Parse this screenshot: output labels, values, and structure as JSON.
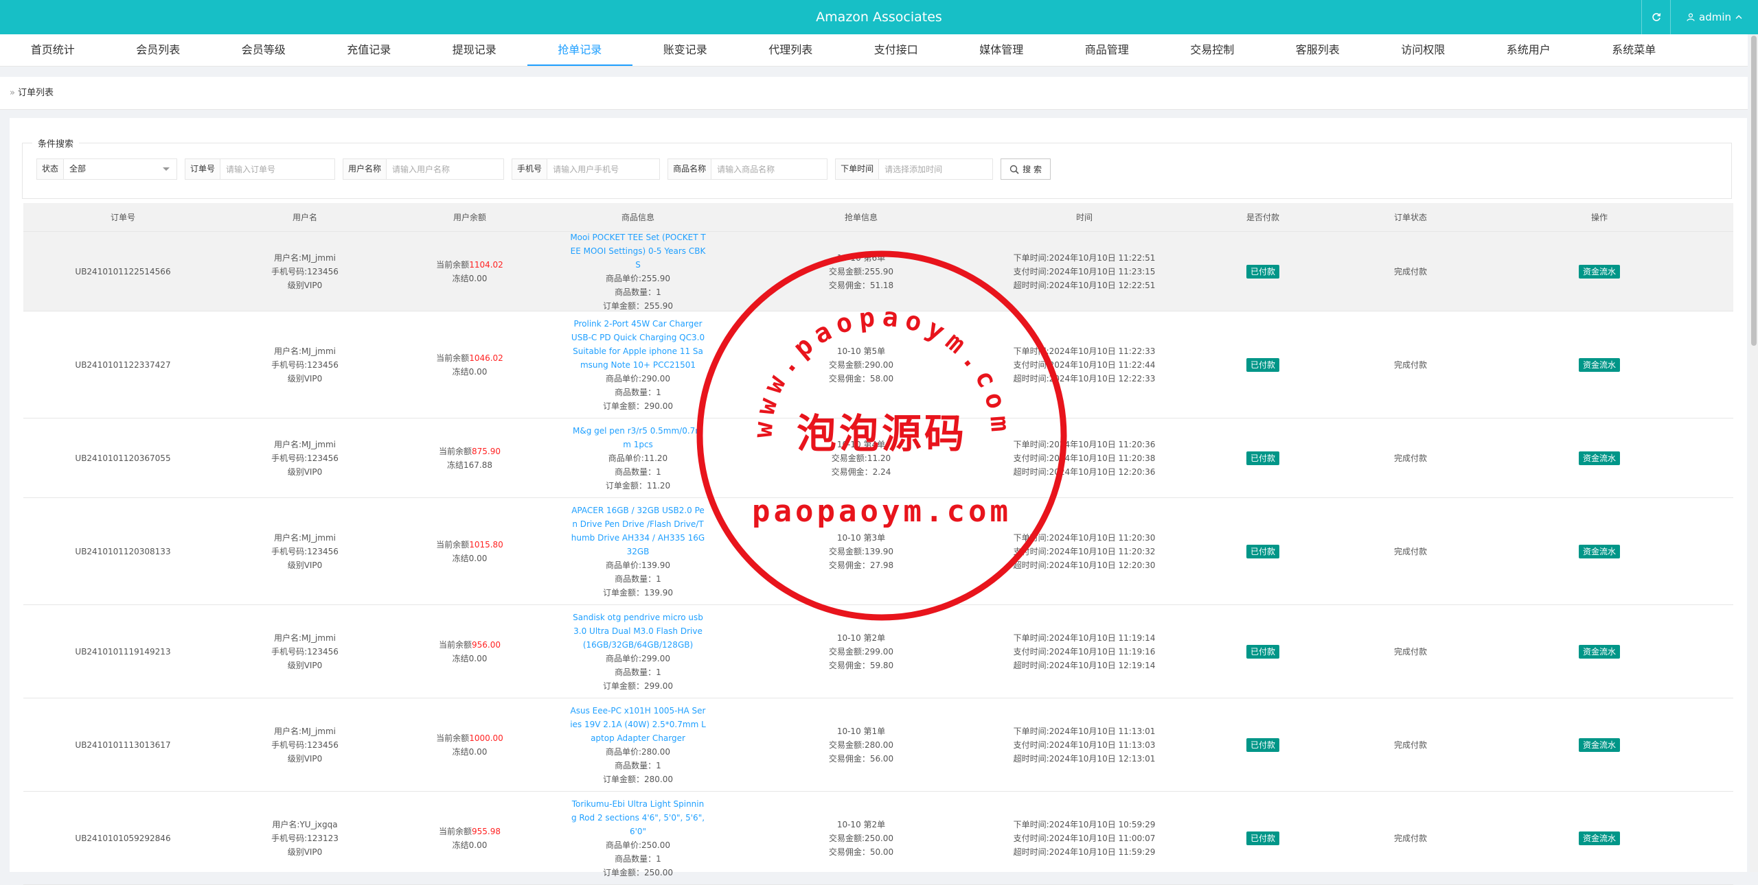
{
  "header": {
    "title": "Amazon Associates",
    "user": "admin",
    "accent": "#17bfc6"
  },
  "nav": [
    "首页统计",
    "会员列表",
    "会员等级",
    "充值记录",
    "提现记录",
    "抢单记录",
    "账变记录",
    "代理列表",
    "支付接口",
    "媒体管理",
    "商品管理",
    "交易控制",
    "客服列表",
    "访问权限",
    "系统用户",
    "系统菜单"
  ],
  "breadcrumb": "订单列表",
  "search": {
    "legend": "条件搜索",
    "status_label": "状态",
    "status_value": "全部",
    "order_label": "订单号",
    "order_placeholder": "请输入订单号",
    "user_label": "用户名称",
    "user_placeholder": "请输入用户名称",
    "phone_label": "手机号",
    "phone_placeholder": "请输入用户手机号",
    "product_label": "商品名称",
    "product_placeholder": "请输入商品名称",
    "time_label": "下单时间",
    "time_placeholder": "请选择添加时间",
    "button": "搜 索"
  },
  "columns": [
    "订单号",
    "用户名",
    "用户余额",
    "商品信息",
    "抢单信息",
    "时间",
    "是否付款",
    "订单状态",
    "操作"
  ],
  "rows": [
    {
      "id": "UB2410101122514566",
      "user": "用户名:MJ_jmmi",
      "phone": "手机号码:123456",
      "level": "级别VIP0",
      "balance_prefix": "当前余额",
      "balance": "1104.02",
      "frozen": "冻结0.00",
      "product": "Mooi POCKET TEE Set (POCKET TEE MOOI Settings) 0-5 Years CBKS",
      "price": "商品单价:255.90",
      "qty": "商品数量：1",
      "amount": "订单金额：255.90",
      "grab1": "10-10 第6单",
      "grab2": "交易金额:255.90",
      "grab3": "交易佣金：51.18",
      "t1": "下单时间:2024年10月10日 11:22:51",
      "t2": "支付时间:2024年10月10日 11:23:15",
      "t3": "超时时间:2024年10月10日 12:22:51",
      "paid": "已付款",
      "state": "完成付款",
      "op": "资金流水"
    },
    {
      "id": "UB2410101122337427",
      "user": "用户名:MJ_jmmi",
      "phone": "手机号码:123456",
      "level": "级别VIP0",
      "balance_prefix": "当前余额",
      "balance": "1046.02",
      "frozen": "冻结0.00",
      "product": "Prolink 2-Port 45W Car Charger USB-C PD Quick Charging QC3.0 Suitable for Apple iphone 11 Samsung Note 10+ PCC21501",
      "price": "商品单价:290.00",
      "qty": "商品数量：1",
      "amount": "订单金额：290.00",
      "grab1": "10-10 第5单",
      "grab2": "交易金额:290.00",
      "grab3": "交易佣金：58.00",
      "t1": "下单时间:2024年10月10日 11:22:33",
      "t2": "支付时间:2024年10月10日 11:22:44",
      "t3": "超时时间:2024年10月10日 12:22:33",
      "paid": "已付款",
      "state": "完成付款",
      "op": "资金流水"
    },
    {
      "id": "UB2410101120367055",
      "user": "用户名:MJ_jmmi",
      "phone": "手机号码:123456",
      "level": "级别VIP0",
      "balance_prefix": "当前余额",
      "balance": "875.90",
      "frozen": "冻结167.88",
      "product": "M&g gel pen r3/r5 0.5mm/0.7mm 1pcs",
      "price": "商品单价:11.20",
      "qty": "商品数量：1",
      "amount": "订单金额：11.20",
      "grab1": "10-10 第4单",
      "grab2": "交易金额:11.20",
      "grab3": "交易佣金：2.24",
      "t1": "下单时间:2024年10月10日 11:20:36",
      "t2": "支付时间:2024年10月10日 11:20:38",
      "t3": "超时时间:2024年10月10日 12:20:36",
      "paid": "已付款",
      "state": "完成付款",
      "op": "资金流水"
    },
    {
      "id": "UB2410101120308133",
      "user": "用户名:MJ_jmmi",
      "phone": "手机号码:123456",
      "level": "级别VIP0",
      "balance_prefix": "当前余额",
      "balance": "1015.80",
      "frozen": "冻结0.00",
      "product": "APACER 16GB / 32GB USB2.0 Pen Drive Pen Drive /Flash Drive/Thumb Drive AH334 / AH335 16G 32GB",
      "price": "商品单价:139.90",
      "qty": "商品数量：1",
      "amount": "订单金额：139.90",
      "grab1": "10-10 第3单",
      "grab2": "交易金额:139.90",
      "grab3": "交易佣金：27.98",
      "t1": "下单时间:2024年10月10日 11:20:30",
      "t2": "支付时间:2024年10月10日 11:20:32",
      "t3": "超时时间:2024年10月10日 12:20:30",
      "paid": "已付款",
      "state": "完成付款",
      "op": "资金流水"
    },
    {
      "id": "UB2410101119149213",
      "user": "用户名:MJ_jmmi",
      "phone": "手机号码:123456",
      "level": "级别VIP0",
      "balance_prefix": "当前余额",
      "balance": "956.00",
      "frozen": "冻结0.00",
      "product": "Sandisk otg pendrive micro usb 3.0 Ultra Dual M3.0 Flash Drive (16GB/32GB/64GB/128GB)",
      "price": "商品单价:299.00",
      "qty": "商品数量：1",
      "amount": "订单金额：299.00",
      "grab1": "10-10 第2单",
      "grab2": "交易金额:299.00",
      "grab3": "交易佣金：59.80",
      "t1": "下单时间:2024年10月10日 11:19:14",
      "t2": "支付时间:2024年10月10日 11:19:16",
      "t3": "超时时间:2024年10月10日 12:19:14",
      "paid": "已付款",
      "state": "完成付款",
      "op": "资金流水"
    },
    {
      "id": "UB2410101113013617",
      "user": "用户名:MJ_jmmi",
      "phone": "手机号码:123456",
      "level": "级别VIP0",
      "balance_prefix": "当前余额",
      "balance": "1000.00",
      "frozen": "冻结0.00",
      "product": "Asus Eee-PC x101H 1005-HA Series 19V 2.1A (40W) 2.5*0.7mm Laptop Adapter Charger",
      "price": "商品单价:280.00",
      "qty": "商品数量：1",
      "amount": "订单金额：280.00",
      "grab1": "10-10 第1单",
      "grab2": "交易金额:280.00",
      "grab3": "交易佣金：56.00",
      "t1": "下单时间:2024年10月10日 11:13:01",
      "t2": "支付时间:2024年10月10日 11:13:03",
      "t3": "超时时间:2024年10月10日 12:13:01",
      "paid": "已付款",
      "state": "完成付款",
      "op": "资金流水"
    },
    {
      "id": "UB2410101059292846",
      "user": "用户名:YU_jxgqa",
      "phone": "手机号码:123123",
      "level": "级别VIP0",
      "balance_prefix": "当前余额",
      "balance": "955.98",
      "frozen": "冻结0.00",
      "product": "Torikumu-Ebi Ultra Light Spinning Rod 2 sections 4'6\", 5'0\", 5'6\", 6'0\"",
      "price": "商品单价:250.00",
      "qty": "商品数量：1",
      "amount": "订单金额：250.00",
      "grab1": "10-10 第2单",
      "grab2": "交易金额:250.00",
      "grab3": "交易佣金：50.00",
      "t1": "下单时间:2024年10月10日 10:59:29",
      "t2": "支付时间:2024年10月10日 11:00:07",
      "t3": "超时时间:2024年10月10日 11:59:29",
      "paid": "已付款",
      "state": "完成付款",
      "op": "资金流水"
    }
  ],
  "watermark": {
    "top": "www.paopaoym.com",
    "middle": "泡泡源码",
    "bottom": "paopaoym.com",
    "color": "#e8141c"
  }
}
